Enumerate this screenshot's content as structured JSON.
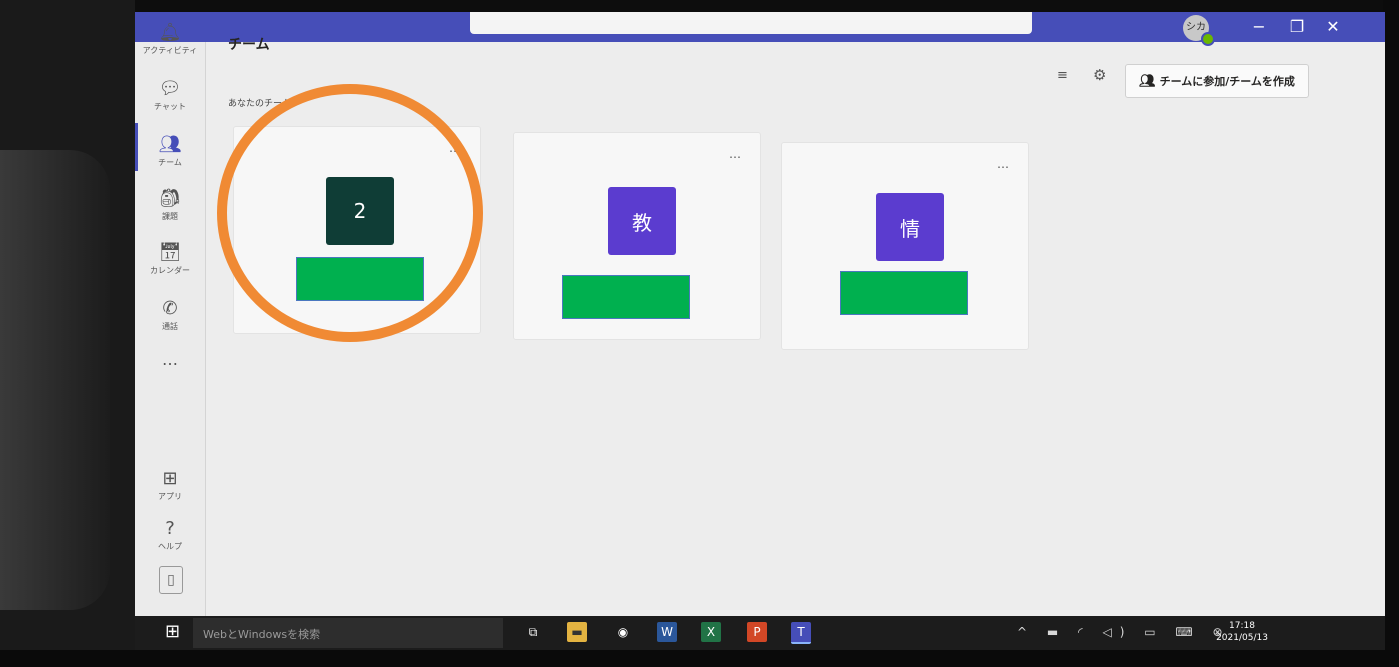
{
  "window": {
    "avatar_initials": "シカ",
    "minimize_glyph": "−",
    "maximize_glyph": "❐",
    "close_glyph": "✕"
  },
  "rail": {
    "items": [
      {
        "label": "アクティビティ",
        "icon": "bell-icon",
        "glyph": "🔔︎"
      },
      {
        "label": "チャット",
        "icon": "chat-icon",
        "glyph": "💬︎"
      },
      {
        "label": "チーム",
        "icon": "teams-icon",
        "glyph": "👥︎"
      },
      {
        "label": "課題",
        "icon": "assignments-icon",
        "glyph": "🎒︎"
      },
      {
        "label": "カレンダー",
        "icon": "calendar-icon",
        "glyph": "📅︎"
      },
      {
        "label": "通話",
        "icon": "phone-icon",
        "glyph": "✆"
      }
    ],
    "more": "…",
    "apps_label": "アプリ",
    "apps_glyph": "⊞",
    "help_label": "ヘルプ",
    "help_glyph": "?",
    "device_glyph": "▯"
  },
  "main": {
    "title": "チーム",
    "section_label": "あなたのチーム",
    "filter_glyph": "≡",
    "settings_glyph": "⚙",
    "join_button_label": "チームに参加/チームを作成",
    "join_glyph": "👥︎"
  },
  "teams": [
    {
      "tile": "2",
      "color": "#0f3d36",
      "more": "…"
    },
    {
      "tile": "教",
      "color": "#5b3ccf",
      "more": "…"
    },
    {
      "tile": "情",
      "color": "#5b3ccf",
      "more": "…"
    }
  ],
  "taskbar": {
    "search_placeholder": "WebとWindowsを検索",
    "start_glyph": "⊞",
    "apps": [
      {
        "icon": "task-view-icon",
        "glyph": "⧉"
      },
      {
        "icon": "file-explorer-icon",
        "glyph": "▬"
      },
      {
        "icon": "camera-icon",
        "glyph": "◉"
      },
      {
        "icon": "word-icon",
        "glyph": "W"
      },
      {
        "icon": "excel-icon",
        "glyph": "X"
      },
      {
        "icon": "powerpoint-icon",
        "glyph": "P"
      },
      {
        "icon": "teams-app-icon",
        "glyph": "T"
      }
    ],
    "tray": "^ ▬ ◜ ◁) ▭ ⌨ ⊗",
    "time": "17:18",
    "date": "2021/05/13"
  },
  "colors": {
    "accent": "#464eb8",
    "highlight": "#f08a34",
    "name_bar": "#00b04f"
  }
}
